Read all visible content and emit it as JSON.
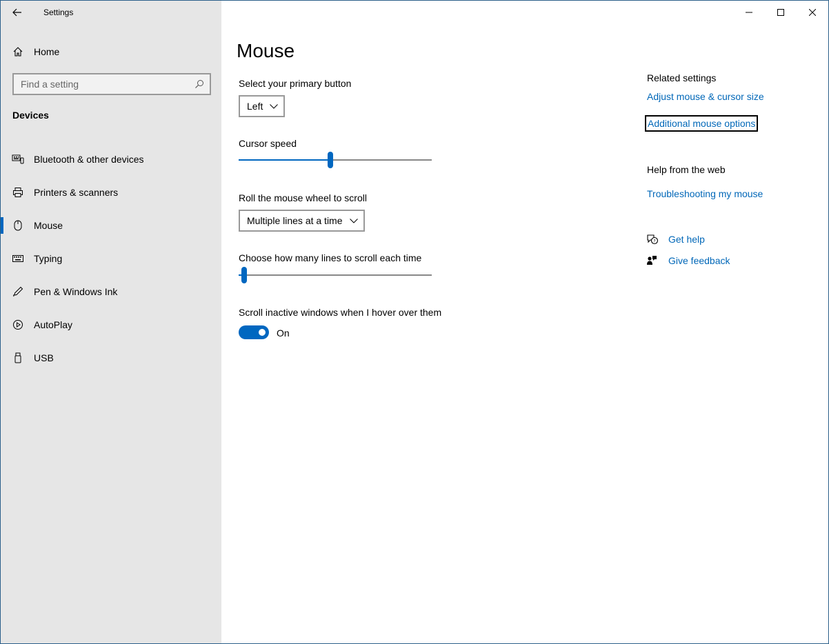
{
  "window": {
    "app_title": "Settings"
  },
  "sidebar": {
    "home_label": "Home",
    "search_placeholder": "Find a setting",
    "section_title": "Devices",
    "items": [
      {
        "label": "Bluetooth & other devices",
        "icon": "bluetooth-devices-icon"
      },
      {
        "label": "Printers & scanners",
        "icon": "printer-icon"
      },
      {
        "label": "Mouse",
        "icon": "mouse-icon",
        "active": true
      },
      {
        "label": "Typing",
        "icon": "keyboard-icon"
      },
      {
        "label": "Pen & Windows Ink",
        "icon": "pen-icon"
      },
      {
        "label": "AutoPlay",
        "icon": "autoplay-icon"
      },
      {
        "label": "USB",
        "icon": "usb-icon"
      }
    ]
  },
  "main": {
    "title": "Mouse",
    "primary_button": {
      "label": "Select your primary button",
      "value": "Left"
    },
    "cursor_speed": {
      "label": "Cursor speed",
      "value_fraction": 0.475
    },
    "wheel_scroll": {
      "label": "Roll the mouse wheel to scroll",
      "value": "Multiple lines at a time"
    },
    "lines_to_scroll": {
      "label": "Choose how many lines to scroll each time",
      "value_fraction": 0.03
    },
    "scroll_inactive": {
      "label": "Scroll inactive windows when I hover over them",
      "state_label": "On"
    }
  },
  "related": {
    "heading": "Related settings",
    "links": [
      "Adjust mouse & cursor size",
      "Additional mouse options"
    ],
    "help_heading": "Help from the web",
    "help_links": [
      "Troubleshooting my mouse"
    ],
    "get_help": "Get help",
    "give_feedback": "Give feedback"
  },
  "colors": {
    "accent": "#0067c0",
    "link": "#0067b8",
    "sidebar_bg": "#e6e6e6"
  }
}
